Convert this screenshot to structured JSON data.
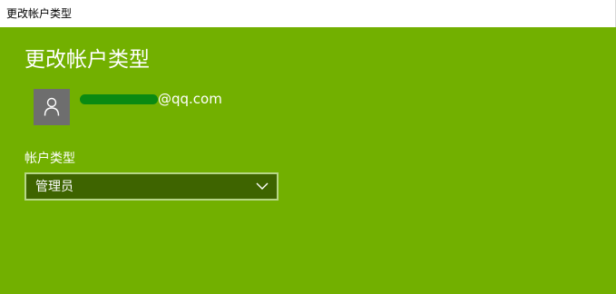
{
  "window": {
    "title": "更改帐户类型"
  },
  "main": {
    "heading": "更改帐户类型",
    "account": {
      "email_suffix": "@qq.com",
      "avatar_icon": "person-icon"
    },
    "account_type": {
      "label": "帐户类型",
      "selected": "管理员",
      "icon": "chevron-down-icon"
    }
  },
  "colors": {
    "background": "#72b000",
    "select_bg": "#3e6400",
    "select_border": "#b6d686",
    "avatar_bg": "#6e6e6e",
    "redaction": "#0a8a12"
  }
}
